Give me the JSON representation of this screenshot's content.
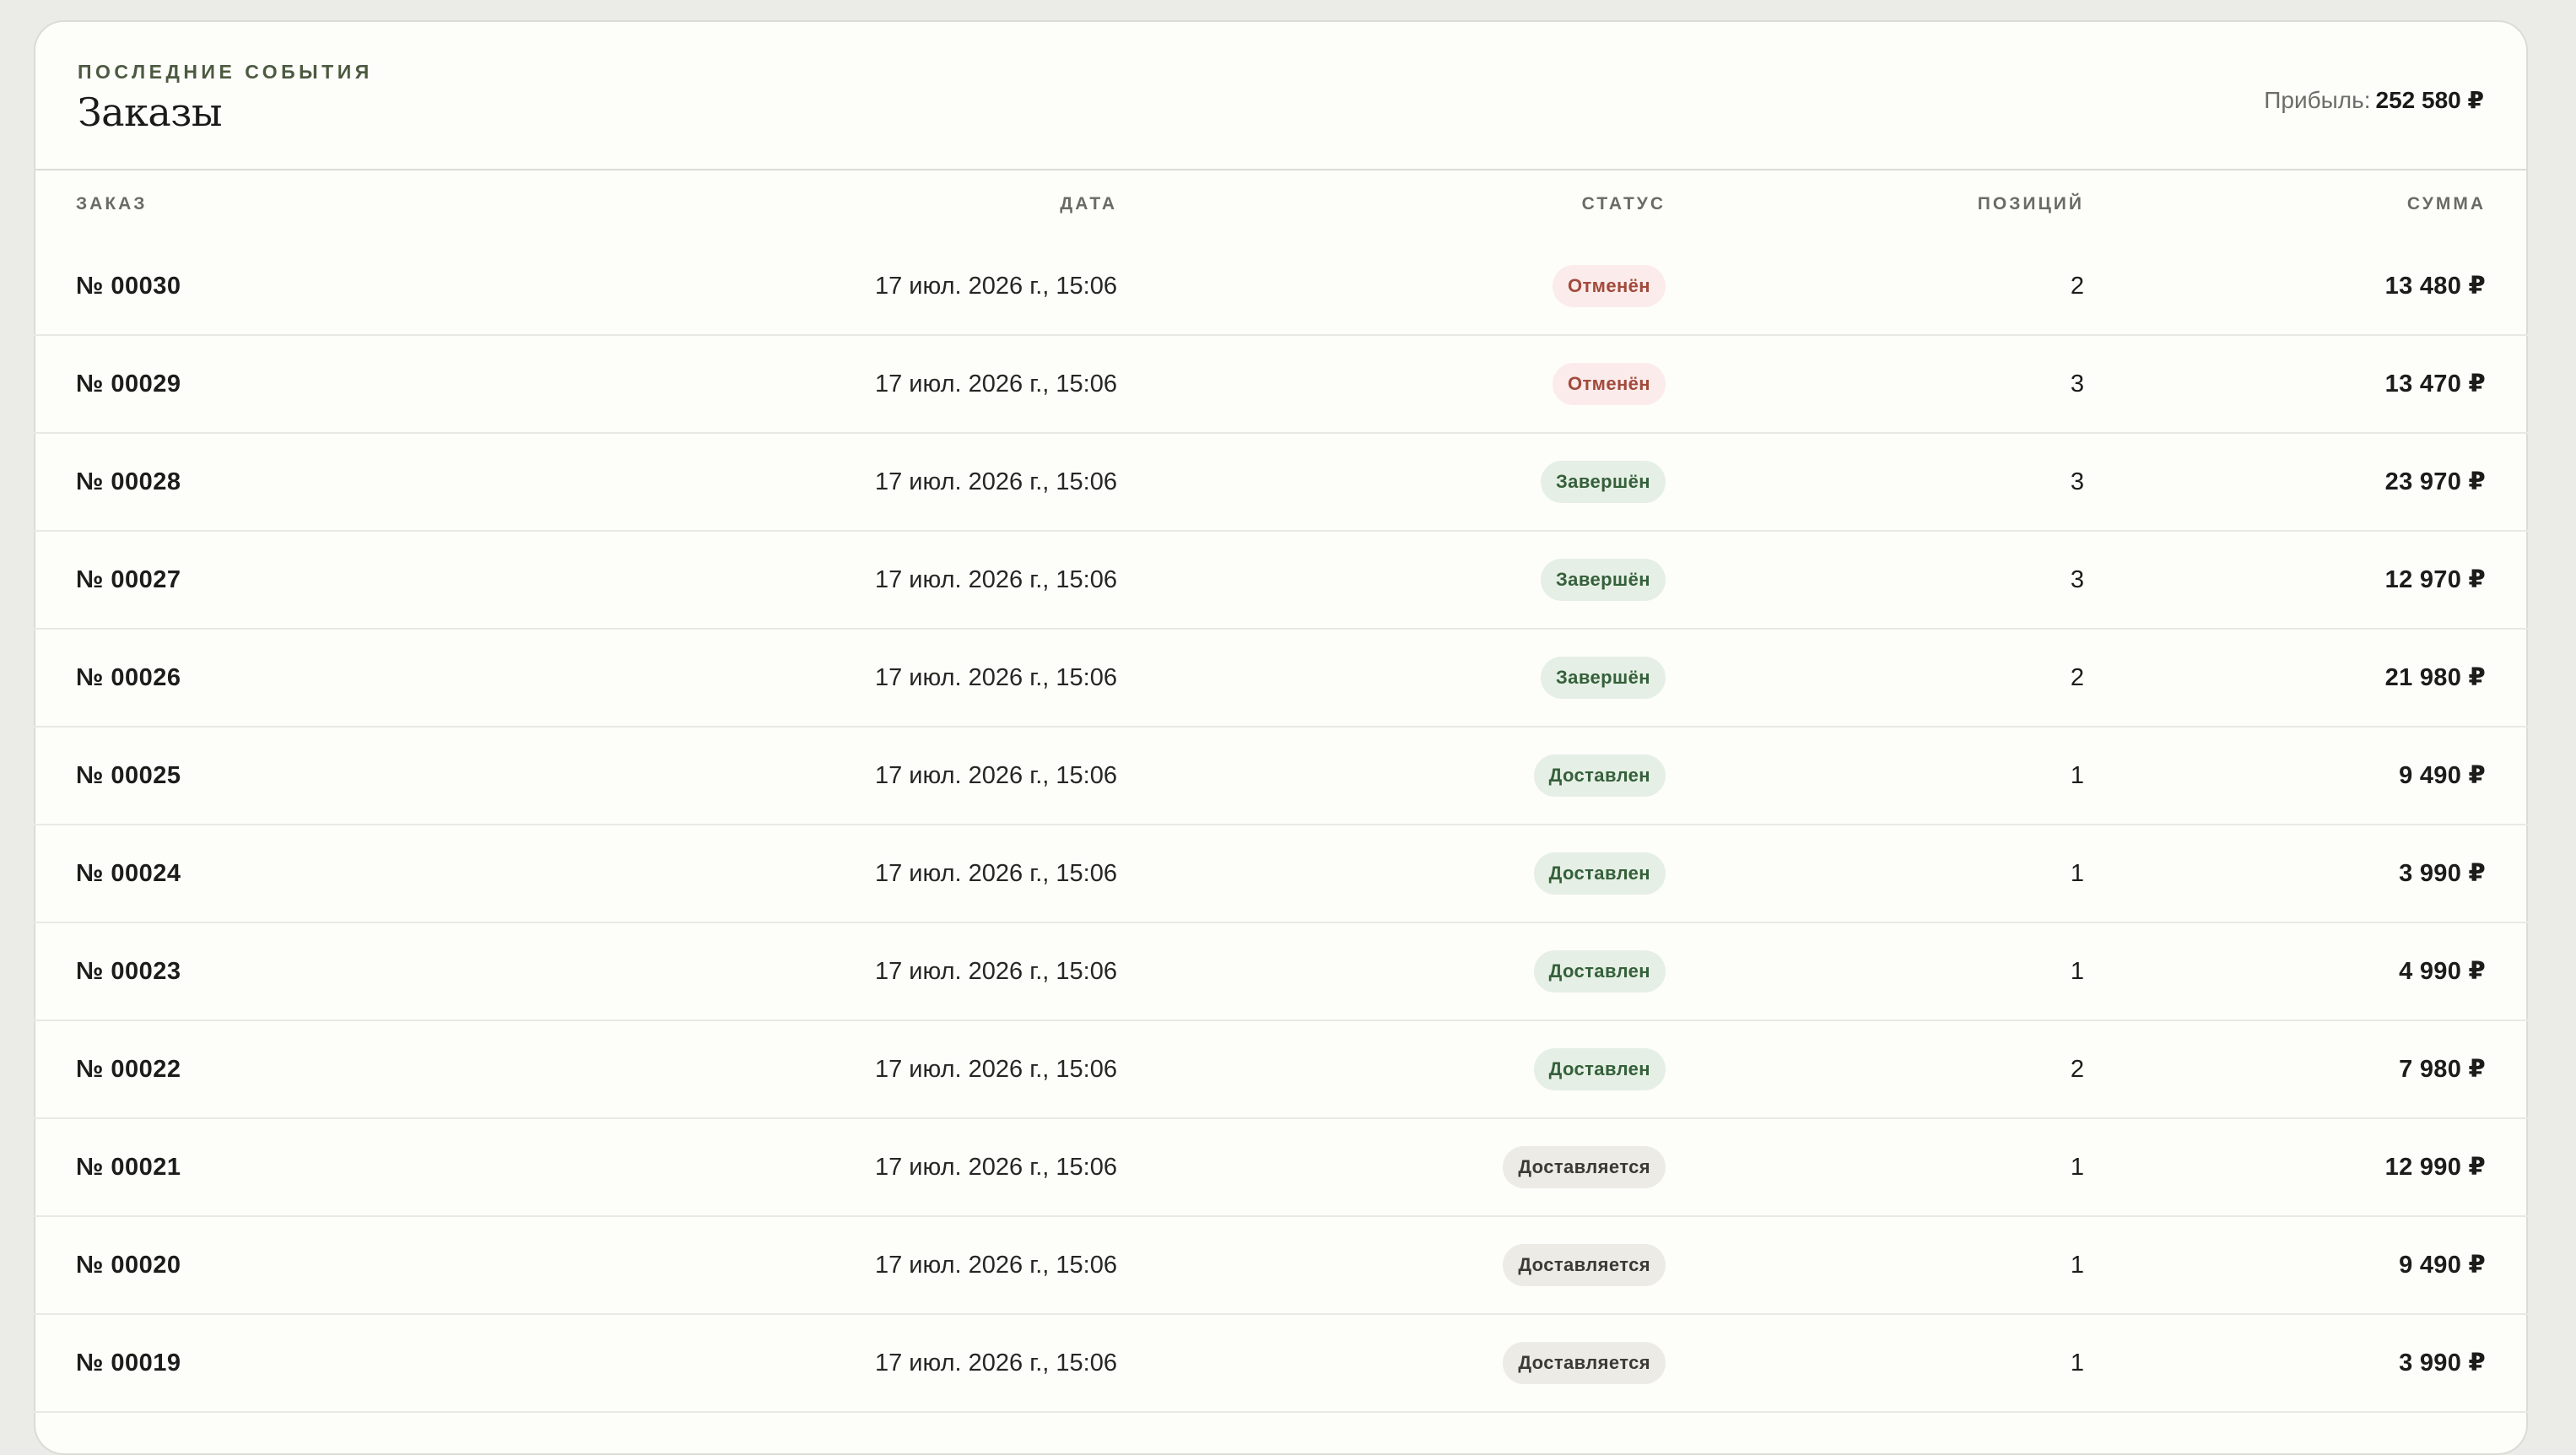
{
  "header": {
    "eyebrow": "ПОСЛЕДНИЕ СОБЫТИЯ",
    "title": "Заказы",
    "profit_label": "Прибыль:",
    "profit_value": "252 580 ₽"
  },
  "table": {
    "columns": {
      "order": "ЗАКАЗ",
      "date": "ДАТА",
      "status": "СТАТУС",
      "items": "ПОЗИЦИЙ",
      "sum": "СУММА"
    },
    "rows": [
      {
        "order": "№ 00030",
        "date": "17 июл. 2026 г., 15:06",
        "status": "Отменён",
        "status_kind": "cancelled",
        "items": "2",
        "sum": "13 480 ₽"
      },
      {
        "order": "№ 00029",
        "date": "17 июл. 2026 г., 15:06",
        "status": "Отменён",
        "status_kind": "cancelled",
        "items": "3",
        "sum": "13 470 ₽"
      },
      {
        "order": "№ 00028",
        "date": "17 июл. 2026 г., 15:06",
        "status": "Завершён",
        "status_kind": "done",
        "items": "3",
        "sum": "23 970 ₽"
      },
      {
        "order": "№ 00027",
        "date": "17 июл. 2026 г., 15:06",
        "status": "Завершён",
        "status_kind": "done",
        "items": "3",
        "sum": "12 970 ₽"
      },
      {
        "order": "№ 00026",
        "date": "17 июл. 2026 г., 15:06",
        "status": "Завершён",
        "status_kind": "done",
        "items": "2",
        "sum": "21 980 ₽"
      },
      {
        "order": "№ 00025",
        "date": "17 июл. 2026 г., 15:06",
        "status": "Доставлен",
        "status_kind": "delivered",
        "items": "1",
        "sum": "9 490 ₽"
      },
      {
        "order": "№ 00024",
        "date": "17 июл. 2026 г., 15:06",
        "status": "Доставлен",
        "status_kind": "delivered",
        "items": "1",
        "sum": "3 990 ₽"
      },
      {
        "order": "№ 00023",
        "date": "17 июл. 2026 г., 15:06",
        "status": "Доставлен",
        "status_kind": "delivered",
        "items": "1",
        "sum": "4 990 ₽"
      },
      {
        "order": "№ 00022",
        "date": "17 июл. 2026 г., 15:06",
        "status": "Доставлен",
        "status_kind": "delivered",
        "items": "2",
        "sum": "7 980 ₽"
      },
      {
        "order": "№ 00021",
        "date": "17 июл. 2026 г., 15:06",
        "status": "Доставляется",
        "status_kind": "shipping",
        "items": "1",
        "sum": "12 990 ₽"
      },
      {
        "order": "№ 00020",
        "date": "17 июл. 2026 г., 15:06",
        "status": "Доставляется",
        "status_kind": "shipping",
        "items": "1",
        "sum": "9 490 ₽"
      },
      {
        "order": "№ 00019",
        "date": "17 июл. 2026 г., 15:06",
        "status": "Доставляется",
        "status_kind": "shipping",
        "items": "1",
        "sum": "3 990 ₽"
      }
    ]
  },
  "colors": {
    "page_background": "#ebebe7",
    "card_background": "#fdfdfa",
    "eyebrow": "#4c5a40",
    "status_cancelled_bg": "#fbeceb",
    "status_cancelled_text": "#a34a3c",
    "status_done_bg": "#e5efe5",
    "status_done_text": "#35603a",
    "status_shipping_bg": "#ecebe5",
    "status_shipping_text": "#3a3a36"
  }
}
